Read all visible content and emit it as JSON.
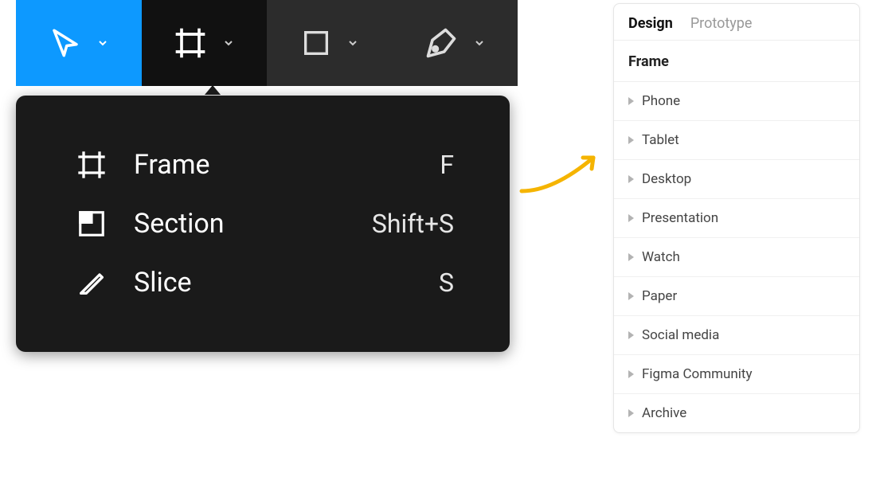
{
  "toolbar": {
    "tools": [
      {
        "name": "move-tool",
        "active": true
      },
      {
        "name": "frame-tool",
        "active": false,
        "open": true
      },
      {
        "name": "shape-tool",
        "active": false
      },
      {
        "name": "pen-tool",
        "active": false
      }
    ],
    "dropdown": [
      {
        "icon": "frame-icon",
        "label": "Frame",
        "shortcut": "F"
      },
      {
        "icon": "section-icon",
        "label": "Section",
        "shortcut": "Shift+S"
      },
      {
        "icon": "slice-icon",
        "label": "Slice",
        "shortcut": "S"
      }
    ]
  },
  "panel": {
    "tabs": [
      {
        "label": "Design",
        "active": true
      },
      {
        "label": "Prototype",
        "active": false
      }
    ],
    "section_title": "Frame",
    "presets": [
      "Phone",
      "Tablet",
      "Desktop",
      "Presentation",
      "Watch",
      "Paper",
      "Social media",
      "Figma Community",
      "Archive"
    ]
  }
}
